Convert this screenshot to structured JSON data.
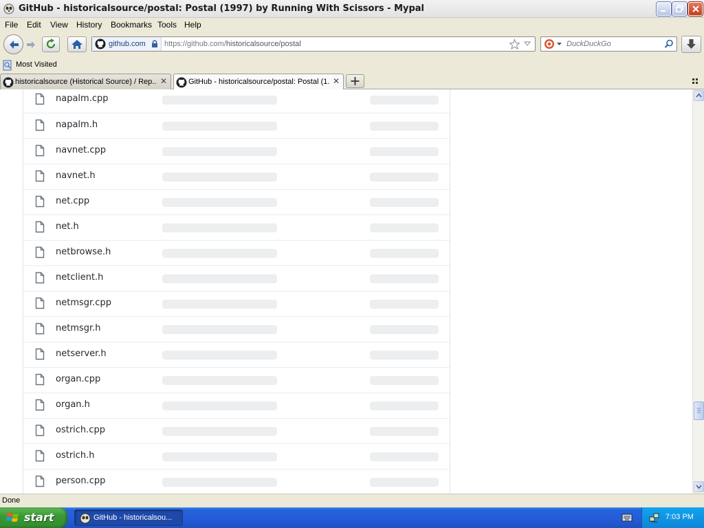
{
  "window": {
    "title": "GitHub - historicalsource/postal: Postal (1997) by Running With Scissors - Mypal"
  },
  "menu": [
    "File",
    "Edit",
    "View",
    "History",
    "Bookmarks",
    "Tools",
    "Help"
  ],
  "urlbar": {
    "host": "github.com",
    "url_prefix": "https://github.com/",
    "url_path": "historicalsource/postal"
  },
  "search": {
    "placeholder": "DuckDuckGo"
  },
  "bookmarks": {
    "most_visited": "Most Visited"
  },
  "tabs": [
    {
      "label": "historicalsource (Historical Source) / Rep...",
      "active": false
    },
    {
      "label": "GitHub - historicalsource/postal: Postal (1...",
      "active": true
    }
  ],
  "files": [
    "napalm.cpp",
    "napalm.h",
    "navnet.cpp",
    "navnet.h",
    "net.cpp",
    "net.h",
    "netbrowse.h",
    "netclient.h",
    "netmsgr.cpp",
    "netmsgr.h",
    "netserver.h",
    "organ.cpp",
    "organ.h",
    "ostrich.cpp",
    "ostrich.h",
    "person.cpp"
  ],
  "status": {
    "text": "Done"
  },
  "taskbar": {
    "start": "start",
    "item": "GitHub - historicalsou...",
    "clock": "7:03 PM"
  },
  "colors": {
    "file_text": "#24292e",
    "skeleton": "#eceeef",
    "taskbar_blue": "#245edb",
    "start_green": "#3c9a36"
  }
}
